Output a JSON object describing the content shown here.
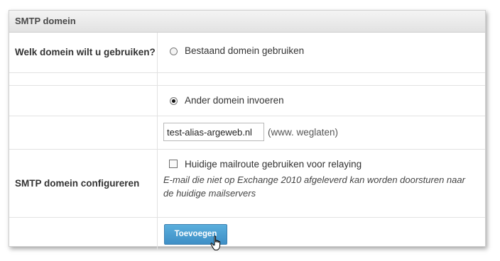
{
  "panel": {
    "title": "SMTP domein"
  },
  "domain_question": {
    "label": "Welk domein wilt u gebruiken?",
    "options": [
      {
        "label": "Bestaand domein gebruiken",
        "checked": false
      },
      {
        "label": "Ander domein invoeren",
        "checked": true
      }
    ]
  },
  "domain_input": {
    "value": "test-alias-argeweb.nl",
    "hint": "(www. weglaten)"
  },
  "smtp_config": {
    "label": "SMTP domein configureren",
    "checkbox_label": "Huidige mailroute gebruiken voor relaying",
    "checked": false,
    "description": "E-mail die niet op Exchange 2010 afgeleverd kan worden doorsturen naar de huidige mailservers"
  },
  "actions": {
    "add_label": "Toevoegen"
  },
  "cursor_icon": "hand-pointer-icon"
}
